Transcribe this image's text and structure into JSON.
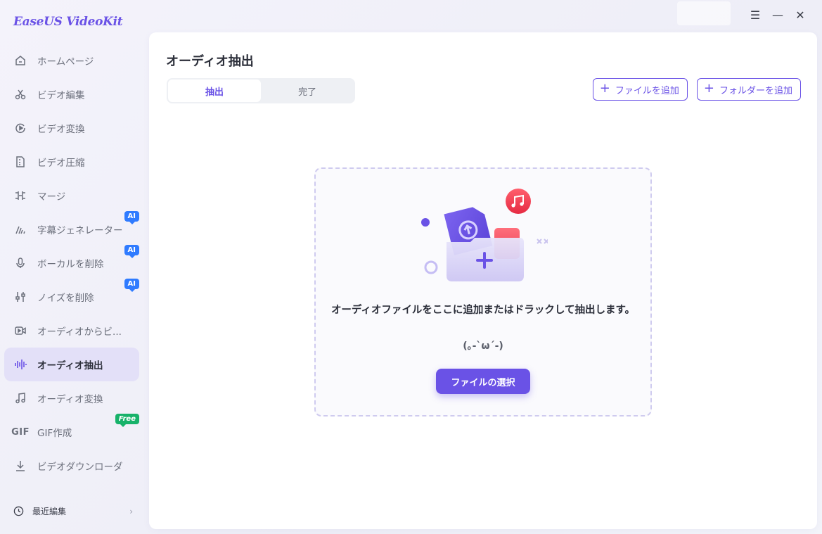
{
  "app": {
    "title": "EaseUS VideoKit"
  },
  "window_controls": {
    "menu": "☰",
    "minimize": "—",
    "close": "✕"
  },
  "sidebar": {
    "items": [
      {
        "label": "ホームページ"
      },
      {
        "label": "ビデオ編集"
      },
      {
        "label": "ビデオ変換"
      },
      {
        "label": "ビデオ圧縮"
      },
      {
        "label": "マージ"
      },
      {
        "label": "字幕ジェネレーター",
        "badge": "AI"
      },
      {
        "label": "ボーカルを削除",
        "badge": "AI"
      },
      {
        "label": "ノイズを削除",
        "badge": "AI"
      },
      {
        "label": "オーディオからビ..."
      },
      {
        "label": "オーディオ抽出",
        "active": true
      },
      {
        "label": "オーディオ変換"
      },
      {
        "label": "GIF作成",
        "badge": "Free",
        "icon_text": "GIF"
      },
      {
        "label": "ビデオダウンローダ"
      }
    ],
    "recent": {
      "label": "最近編集",
      "chevron": "›"
    }
  },
  "main": {
    "title": "オーディオ抽出",
    "tabs": [
      {
        "label": "抽出",
        "active": true
      },
      {
        "label": "完了"
      }
    ],
    "actions": {
      "add_file": "ファイルを追加",
      "add_folder": "フォルダーを追加"
    },
    "dropzone": {
      "text": "オーディオファイルをここに追加またはドラックして抽出します。",
      "kaomoji": "(｡-`ω´-)",
      "button": "ファイルの選択"
    }
  },
  "colors": {
    "accent": "#6a52e6",
    "ai_badge": "#2f7bff",
    "free_badge": "#17b26a",
    "music_icon": "#ef3b4f"
  }
}
